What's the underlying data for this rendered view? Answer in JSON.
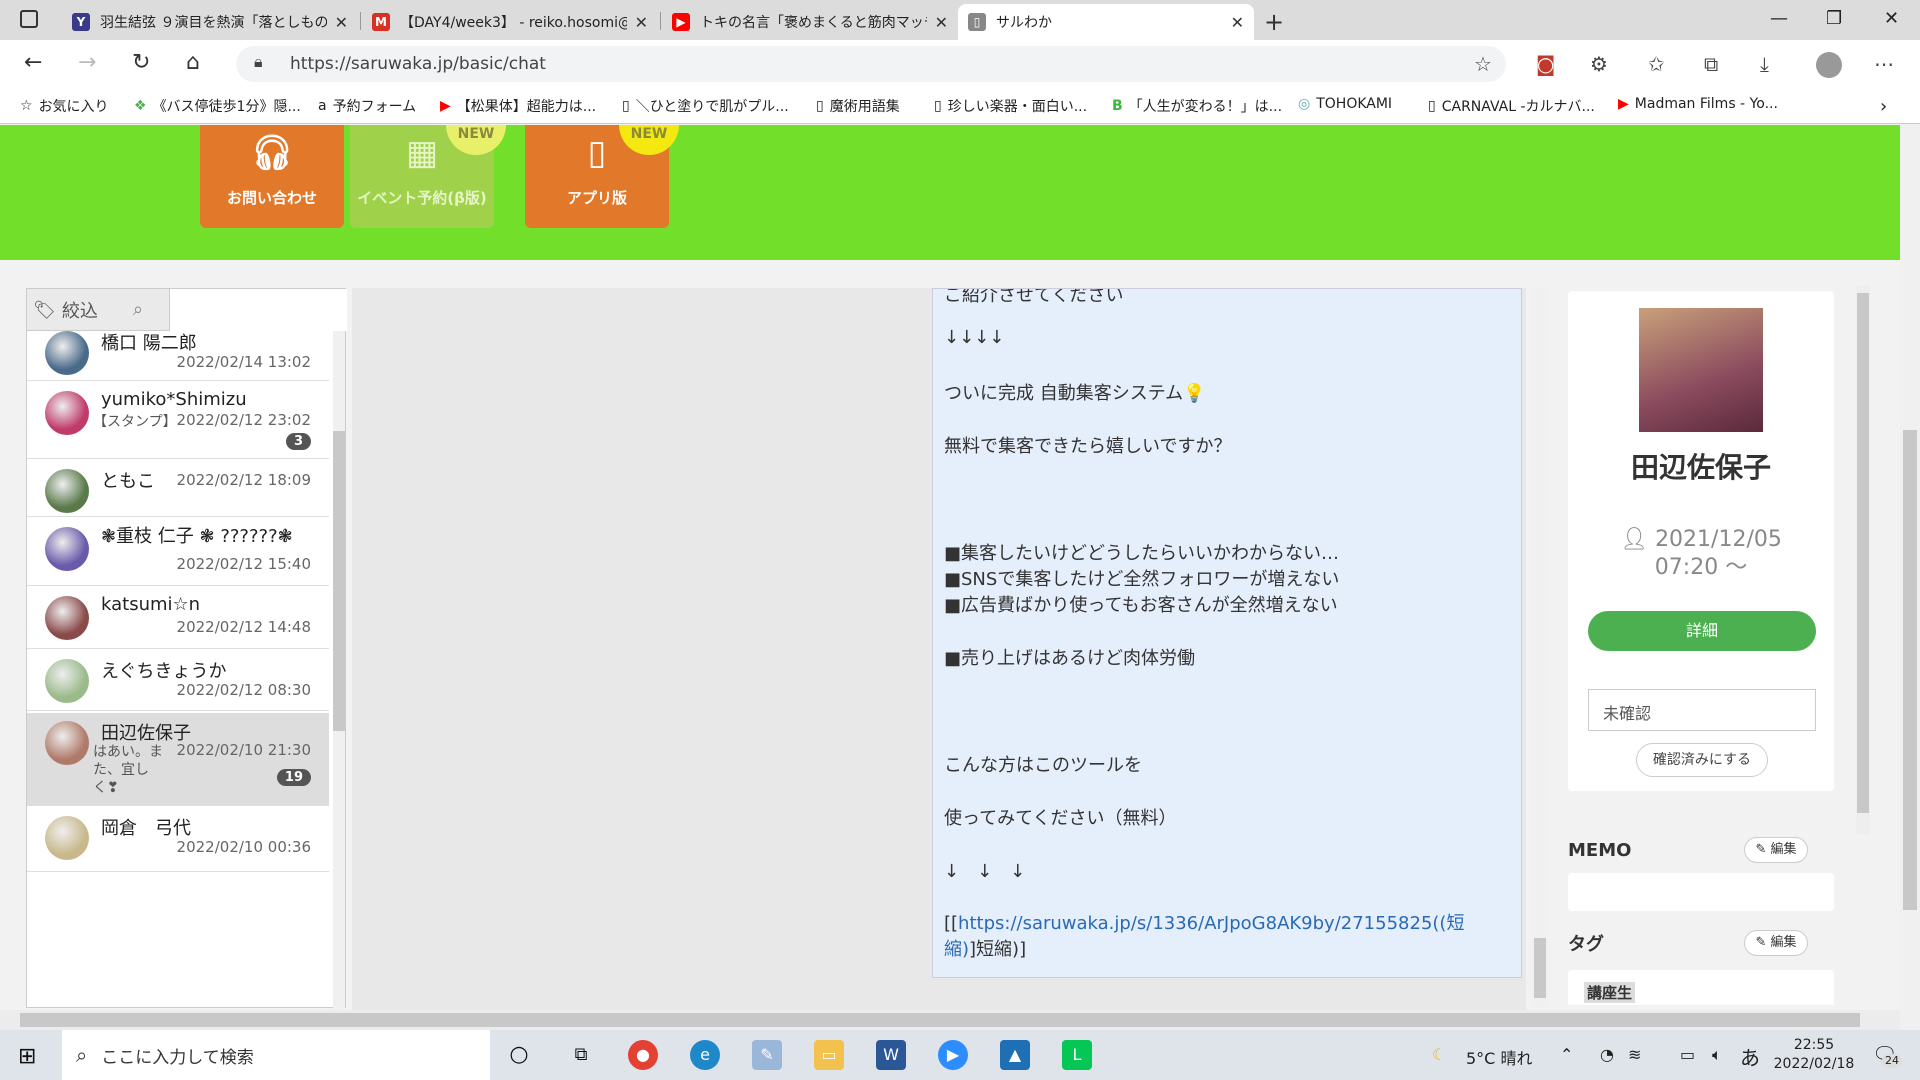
{
  "browser": {
    "tabs": [
      {
        "title": "羽生結弦 ９演目を熱演「落としもの」",
        "fav_color": "#3a3a8a",
        "fav": "Y"
      },
      {
        "title": "【DAY4/week3】 - reiko.hosomi@",
        "fav_color": "#d93025",
        "fav": "M"
      },
      {
        "title": "トキの名言「褒めまくると筋肉マッチョ",
        "fav_color": "#ff0000",
        "fav": "▶"
      },
      {
        "title": "サルわか",
        "fav_color": "#888888",
        "fav": "▯"
      }
    ],
    "url": "https://saruwaka.jp/basic/chat",
    "bookmarks": [
      {
        "label": "お気に入り",
        "icon": "☆"
      },
      {
        "label": "《バス停徒歩1分》隠...",
        "icon": "❖"
      },
      {
        "label": "予約フォーム",
        "icon": "a"
      },
      {
        "label": "【松果体】超能力は...",
        "icon": "▶"
      },
      {
        "label": "＼ひと塗りで肌がプル...",
        "icon": "▯"
      },
      {
        "label": "魔術用語集",
        "icon": "▯"
      },
      {
        "label": "珍しい楽器・面白い...",
        "icon": "▯"
      },
      {
        "label": "「人生が変わる！」は...",
        "icon": "B"
      },
      {
        "label": "TOHOKAMI",
        "icon": "◎"
      },
      {
        "label": "CARNAVAL -カルナバ...",
        "icon": "▯"
      },
      {
        "label": "Madman Films - Yo...",
        "icon": "▶"
      }
    ]
  },
  "topnav": {
    "contact": "お問い合わせ",
    "event": "イベント予約(β版)",
    "app": "アプリ版",
    "new_badge": "NEW"
  },
  "filter": {
    "label": "絞込"
  },
  "conversations": [
    {
      "name": "橋口 陽二郎",
      "date": "2022/02/14 13:02",
      "preview": "",
      "badge": "",
      "color": "#4a6a8a"
    },
    {
      "name": "yumiko*Shimizu",
      "date": "2022/02/12 23:02",
      "preview": "【スタンプ】",
      "badge": "3",
      "color": "#c03a6a"
    },
    {
      "name": "ともこ",
      "date": "2022/02/12 18:09",
      "preview": "",
      "badge": "",
      "color": "#5a7a4a"
    },
    {
      "name": "❃重枝 仁子 ❃ ??????❃",
      "date": "2022/02/12 15:40",
      "preview": "",
      "badge": "",
      "color": "#6a5aaa"
    },
    {
      "name": "katsumi☆n",
      "date": "2022/02/12 14:48",
      "preview": "",
      "badge": "",
      "color": "#8a4a4a"
    },
    {
      "name": "えぐちきょうか",
      "date": "2022/02/12 08:30",
      "preview": "",
      "badge": "",
      "color": "#9aba8a"
    },
    {
      "name": "田辺佐保子",
      "date": "2022/02/10 21:30",
      "preview": "はあい。また、宜しく❣",
      "badge": "19",
      "color": "#b07a6a"
    },
    {
      "name": "岡倉　弓代",
      "date": "2022/02/10 00:36",
      "preview": "",
      "badge": "",
      "color": "#c8b88a"
    }
  ],
  "message": {
    "lines": [
      "ご紹介させてください",
      "↓↓↓↓",
      "ついに完成 自動集客システム💡",
      "無料で集客できたら嬉しいですか？",
      "■集客したいけどどうしたらいいかわからない…",
      "■SNSで集客したけど全然フォロワーが増えない",
      "■広告費ばかり使ってもお客さんが全然増えない",
      "■売り上げはあるけど肉体労働",
      "こんな方はこのツールを",
      "使ってみてください（無料）",
      "↓　↓　↓"
    ],
    "link_prefix": "[[",
    "link_text": "https://saruwaka.jp/s/1336/ArJpoG8AK9by/27155825((短",
    "link_text2": "縮)",
    "link_suffix": "]短縮)]"
  },
  "profile": {
    "name": "田辺佐保子",
    "date_line1": "2021/12/05",
    "date_line2": "07:20 〜",
    "detail_button": "詳細",
    "status": "未確認",
    "confirm_button": "確認済みにする",
    "memo_label": "MEMO",
    "tag_label": "タグ",
    "edit_label": "編集",
    "tag_partial": "講座生"
  },
  "taskbar": {
    "search_placeholder": "ここに入力して検索",
    "weather": "5°C 晴れ",
    "ime": "あ",
    "time": "22:55",
    "date": "2022/02/18",
    "notifications": "24"
  }
}
